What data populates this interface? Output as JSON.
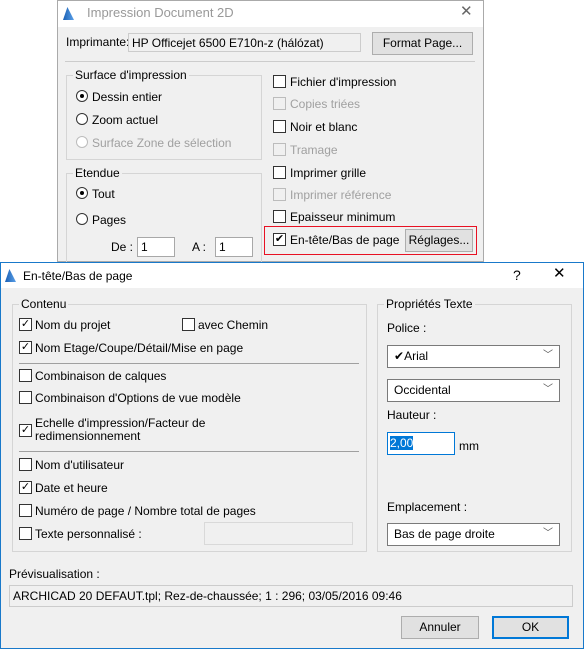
{
  "print_dialog": {
    "title": "Impression Document 2D",
    "printer_label": "Imprimante:",
    "printer_value": "HP Officejet 6500 E710n-z (hálózat)",
    "format_page_button": "Format Page...",
    "surface_group": {
      "label": "Surface d'impression",
      "options": [
        {
          "label": "Dessin entier",
          "selected": true,
          "enabled": true
        },
        {
          "label": "Zoom actuel",
          "selected": false,
          "enabled": true
        },
        {
          "label": "Surface Zone de sélection",
          "selected": false,
          "enabled": false
        }
      ]
    },
    "range_group": {
      "label": "Etendue",
      "options": [
        {
          "label": "Tout",
          "selected": true
        },
        {
          "label": "Pages",
          "selected": false
        }
      ],
      "from_label": "De :",
      "from_value": "1",
      "to_label": "A :",
      "to_value": "1"
    },
    "options": [
      {
        "label": "Fichier d'impression",
        "checked": false,
        "enabled": true
      },
      {
        "label": "Copies triées",
        "checked": false,
        "enabled": false
      },
      {
        "label": "Noir et blanc",
        "checked": false,
        "enabled": true
      },
      {
        "label": "Tramage",
        "checked": false,
        "enabled": false
      },
      {
        "label": "Imprimer grille",
        "checked": false,
        "enabled": true
      },
      {
        "label": "Imprimer référence",
        "checked": false,
        "enabled": false
      },
      {
        "label": "Epaisseur minimum",
        "checked": false,
        "enabled": true
      },
      {
        "label": "En-tête/Bas de page",
        "checked": true,
        "enabled": true
      }
    ],
    "settings_button": "Réglages...",
    "highlight_color": "#e81123"
  },
  "header_footer_dialog": {
    "title": "En-tête/Bas de page",
    "help": "?",
    "content_group": {
      "label": "Contenu",
      "items": [
        {
          "label": "Nom du projet",
          "checked": true
        },
        {
          "label": "avec Chemin",
          "checked": false
        },
        {
          "label": "Nom Etage/Coupe/Détail/Mise en page",
          "checked": true
        },
        {
          "label": "Combinaison de calques",
          "checked": false
        },
        {
          "label": "Combinaison d'Options de vue modèle",
          "checked": false
        },
        {
          "label": "Echelle d'impression/Facteur de",
          "label2": "redimensionnement",
          "checked": true
        },
        {
          "label": "Nom d'utilisateur",
          "checked": false
        },
        {
          "label": "Date et heure",
          "checked": true
        },
        {
          "label": "Numéro de page / Nombre total de pages",
          "checked": false
        },
        {
          "label": "Texte personnalisé :",
          "checked": false
        }
      ],
      "custom_text_value": ""
    },
    "text_props": {
      "label": "Propriétés Texte",
      "font_label": "Police :",
      "font_value": "Arial",
      "charset_value": "Occidental",
      "height_label": "Hauteur :",
      "height_value": "2,00",
      "height_unit": "mm",
      "position_label": "Emplacement :",
      "position_value": "Bas de page droite"
    },
    "preview_label": "Prévisualisation :",
    "preview_value": "ARCHICAD 20 DEFAUT.tpl; Rez-de-chaussée; 1 : 296; 03/05/2016 09:46",
    "cancel_button": "Annuler",
    "ok_button": "OK",
    "accent_color": "#0078d7"
  }
}
